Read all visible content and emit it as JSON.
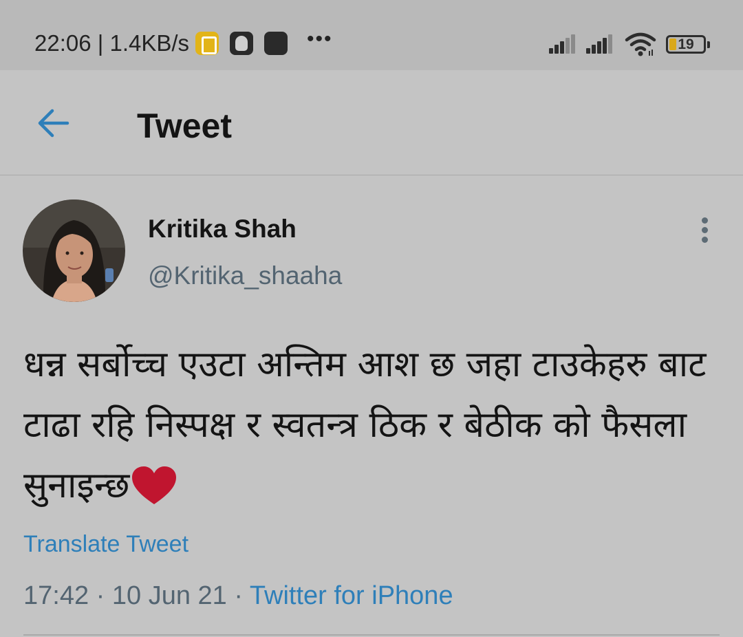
{
  "status_bar": {
    "time": "22:06 | 1.4KB/s",
    "dots": "•••",
    "battery_level": "19",
    "icons": [
      "app-yellow-icon",
      "app-face-icon",
      "app-dark-icon",
      "signal-icon",
      "signal-icon",
      "wifi-icon",
      "battery-icon"
    ]
  },
  "header": {
    "title": "Tweet",
    "back_icon": "arrow-left-icon"
  },
  "tweet": {
    "display_name": "Kritika Shah",
    "handle": "@Kritika_shaaha",
    "text": "धन्न सर्बोच्च एउटा अन्तिम आश छ जहा टाउकेहरु बाट टाढा रहि निस्पक्ष र स्वतन्त्र ठिक र बेठीक को फैसला सुनाइन्छ",
    "emoji": "heart-icon",
    "translate_label": "Translate Tweet",
    "time": "17:42",
    "separator": "·",
    "date": "10 Jun 21",
    "source": "Twitter for iPhone"
  },
  "colors": {
    "background": "#c4c4c4",
    "status_bar": "#b9b9b9",
    "accent": "#2e7fb9",
    "secondary_text": "#536471",
    "heart": "#c0152f"
  }
}
